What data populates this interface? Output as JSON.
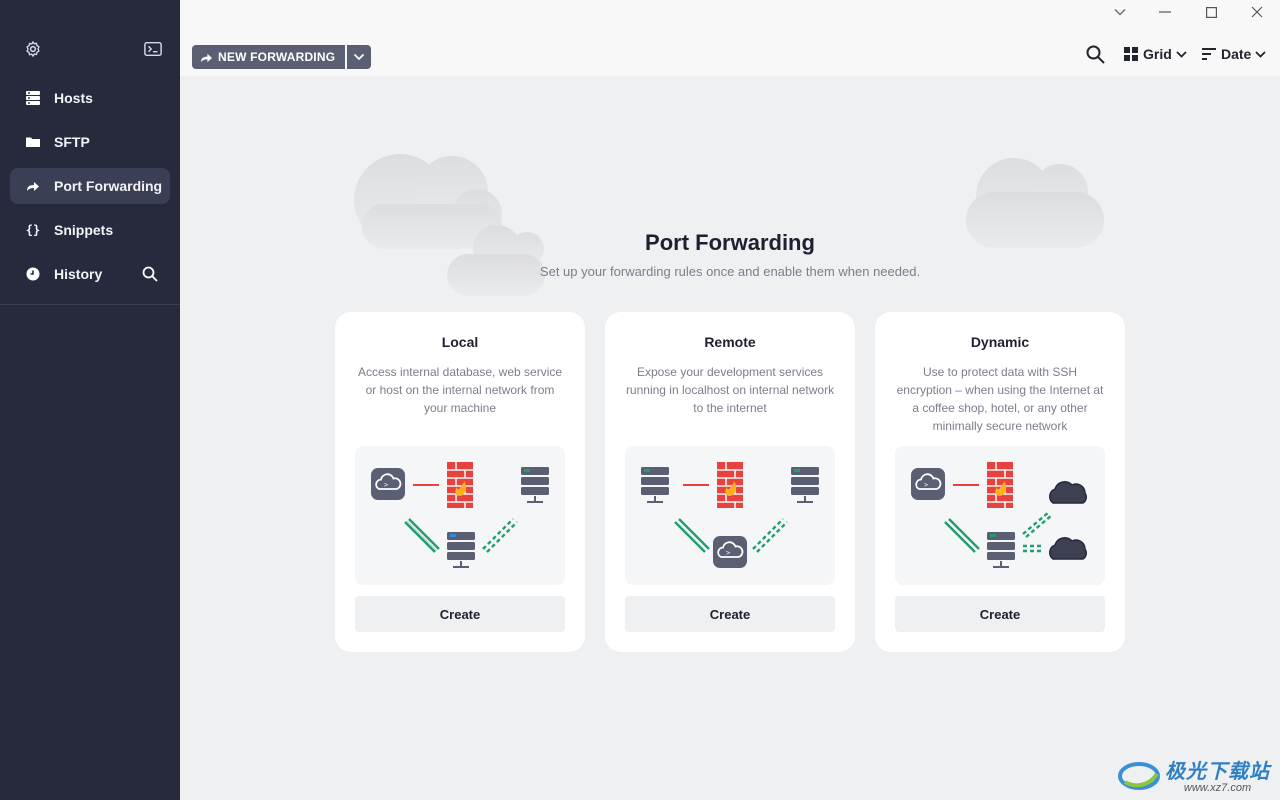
{
  "sidebar": {
    "items": [
      {
        "label": "Hosts",
        "icon": "hosts-icon"
      },
      {
        "label": "SFTP",
        "icon": "folder-icon"
      },
      {
        "label": "Port Forwarding",
        "icon": "port-forwarding-icon",
        "active": true
      },
      {
        "label": "Snippets",
        "icon": "braces-icon"
      },
      {
        "label": "History",
        "icon": "clock-icon"
      }
    ]
  },
  "toolbar": {
    "new_forwarding_label": "NEW FORWARDING",
    "view_label": "Grid",
    "sort_label": "Date"
  },
  "hero": {
    "title": "Port Forwarding",
    "subtitle": "Set up your forwarding rules once and enable them when needed."
  },
  "cards": [
    {
      "title": "Local",
      "description": "Access internal database, web service or host on the internal network from your machine",
      "button": "Create"
    },
    {
      "title": "Remote",
      "description": "Expose your development services running in localhost on internal network to the internet",
      "button": "Create"
    },
    {
      "title": "Dynamic",
      "description": "Use to protect data with SSH encryption – when using the Internet at a coffee shop, hotel, or any other minimally secure network",
      "button": "Create"
    }
  ],
  "watermark": {
    "name": "极光下载站",
    "url": "www.xz7.com"
  },
  "colors": {
    "sidebar_bg": "#272a3c",
    "active_item": "#3b3f55",
    "firewall_red": "#e8423f",
    "tunnel_green": "#1f9e6e",
    "server_gray": "#5b5f73"
  }
}
